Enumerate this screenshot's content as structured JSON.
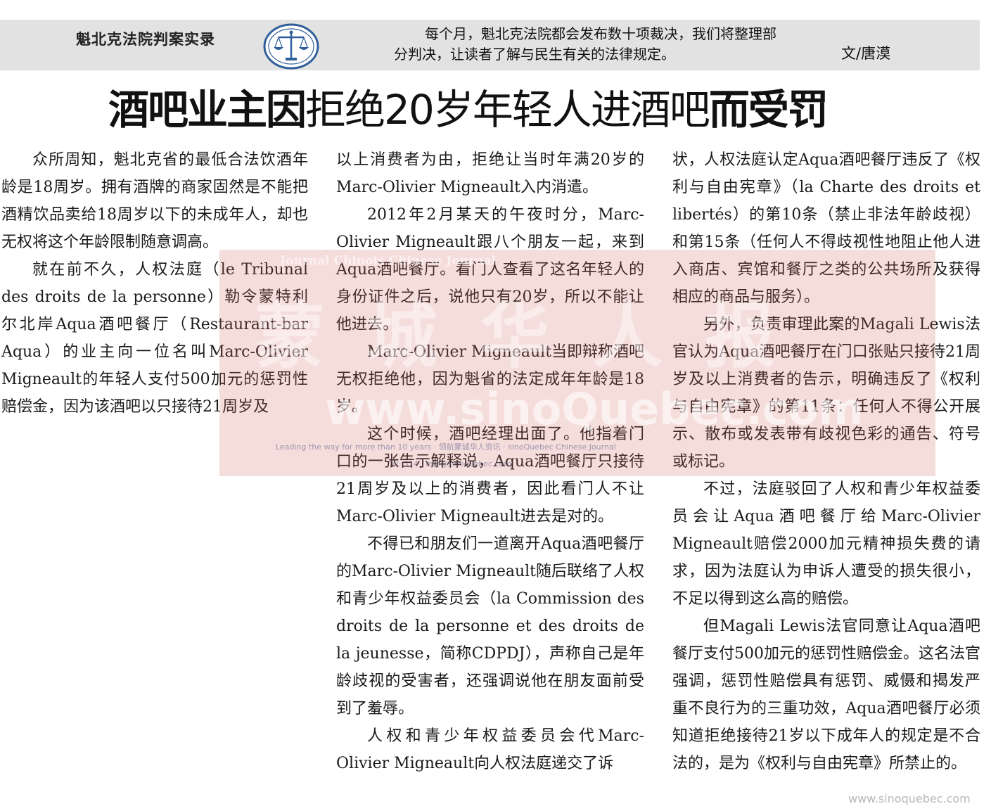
{
  "header": {
    "column_name": "魁北克法院判案实录",
    "intro_line1": "每个月，魁北克法院都会发布数十项裁决，我们将整理部",
    "intro_line2": "分判决，让读者了解与民生有关的法律规定。",
    "byline": "文/唐漠",
    "emblem_icon": "scales-of-justice-icon"
  },
  "headline": {
    "part1": "酒吧业主因",
    "part2": "拒绝20岁年轻人进酒吧",
    "part3": "而受罚"
  },
  "article": {
    "col1": [
      "众所周知，魁北克省的最低合法饮酒年龄是18周岁。拥有酒牌的商家固然是不能把酒精饮品卖给18周岁以下的未成年人，却也无权将这个年龄限制随意调高。",
      "就在前不久，人权法庭（le Tribunal des droits de la personne）勒令蒙特利尔北岸Aqua酒吧餐厅（Restaurant-bar Aqua）的业主向一位名叫Marc-Olivier Migneault的年轻人支付500加元的惩罚性赔偿金，因为该酒吧以只接待21周岁及"
    ],
    "col2": [
      "以上消费者为由，拒绝让当时年满20岁的Marc-Olivier Migneault入内消遣。",
      "2012年2月某天的午夜时分，Marc-Olivier Migneault跟八个朋友一起，来到Aqua酒吧餐厅。看门人查看了这名年轻人的身份证件之后，说他只有20岁，所以不能让他进去。",
      "Marc-Olivier Migneault当即辩称酒吧无权拒绝他，因为魁省的法定成年年龄是18岁。",
      "这个时候，酒吧经理出面了。他指着门口的一张告示解释说，Aqua酒吧餐厅只接待21周岁及以上的消费者，因此看门人不让Marc-Olivier Migneault进去是对的。",
      "不得已和朋友们一道离开Aqua酒吧餐厅的Marc-Olivier Migneault随后联络了人权和青少年权益委员会（la Commission des droits de la personne et des droits de la jeunesse，简称CDPDJ），声称自己是年龄歧视的受害者，还强调说他在朋友面前受到了羞辱。",
      "人权和青少年权益委员会代Marc-Olivier Migneault向人权法庭递交了诉"
    ],
    "col3": [
      "状，人权法庭认定Aqua酒吧餐厅违反了《权利与自由宪章》（la Charte des droits et libertés）的第10条（禁止非法年龄歧视）和第15条（任何人不得歧视性地阻止他人进入商店、宾馆和餐厅之类的公共场所及获得相应的商品与服务）。",
      "另外，负责审理此案的Magali Lewis法官认为Aqua酒吧餐厅在门口张贴只接待21周岁及以上消费者的告示，明确违反了《权利与自由宪章》的第11条：任何人不得公开展示、散布或发表带有歧视色彩的通告、符号或标记。",
      "不过，法庭驳回了人权和青少年权益委员会让Aqua酒吧餐厅给Marc-Olivier Migneault赔偿2000加元精神损失费的请求，因为法庭认为申诉人遭受的损失很小，不足以得到这么高的赔偿。",
      "但Magali Lewis法官同意让Aqua酒吧餐厅支付500加元的惩罚性赔偿金。这名法官强调，惩罚性赔偿具有惩罚、威慑和揭发严重不良行为的三重功效，Aqua酒吧餐厅必须知道拒绝接待21岁以下成年人的规定是不合法的，是为《权利与自由宪章》所禁止的。"
    ]
  },
  "watermark": {
    "top_text": "Journal Chinois                          Chinese Journal",
    "chars": "蒙城华人报",
    "url": "www.sinoQuebec.com",
    "slogan": "Leading the way for more than 10 years · 领航蒙城华人资讯 · sinoQuebec Chinese Journal",
    "contact": "Tel: 514 · info@sinoquebec.com"
  },
  "footer": {
    "url": "www.sinoquebec.com"
  }
}
